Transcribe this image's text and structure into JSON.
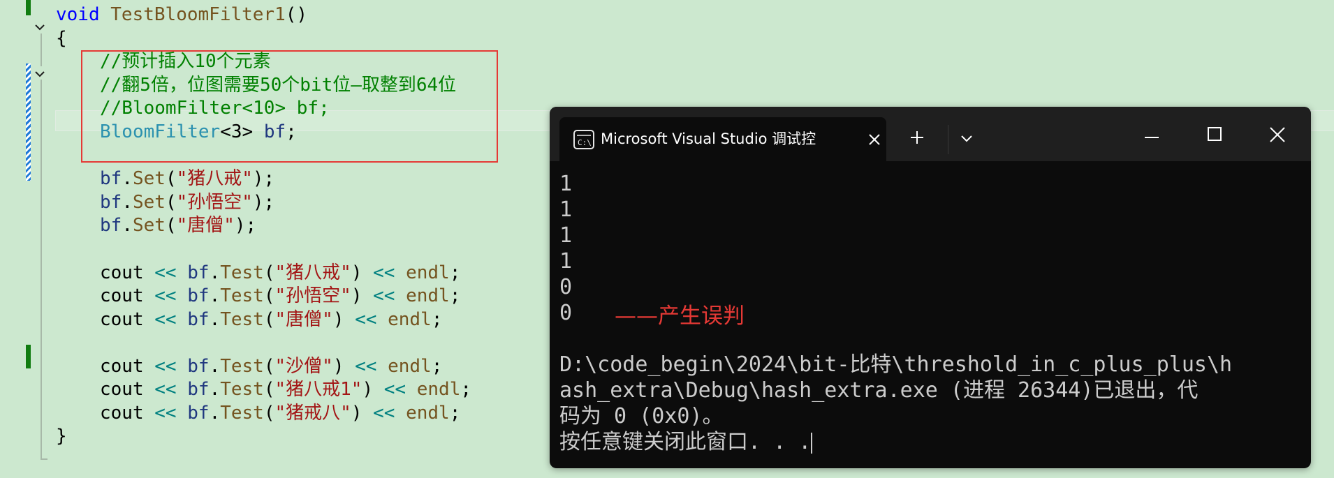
{
  "editor": {
    "lines": [
      {
        "id": "l1",
        "segs": [
          {
            "c": "kw",
            "t": "void"
          },
          {
            "c": "",
            "t": " "
          },
          {
            "c": "fn",
            "t": "TestBloomFilter1"
          },
          {
            "c": "",
            "t": "()"
          }
        ]
      },
      {
        "id": "l2",
        "segs": [
          {
            "c": "",
            "t": "{"
          }
        ]
      },
      {
        "id": "l3",
        "segs": [
          {
            "c": "cm",
            "t": "//预计插入10个元素"
          }
        ]
      },
      {
        "id": "l4",
        "segs": [
          {
            "c": "cm",
            "t": "//翻5倍，位图需要50个bit位—取整到64位"
          }
        ]
      },
      {
        "id": "l5",
        "segs": [
          {
            "c": "cm",
            "t": "//BloomFilter<10> bf;"
          }
        ]
      },
      {
        "id": "l6",
        "segs": [
          {
            "c": "ty",
            "t": "BloomFilter"
          },
          {
            "c": "",
            "t": "<3> "
          },
          {
            "c": "vr",
            "t": "bf"
          },
          {
            "c": "",
            "t": ";"
          }
        ]
      },
      {
        "id": "l7",
        "segs": [
          {
            "c": "vr",
            "t": "bf"
          },
          {
            "c": "",
            "t": "."
          },
          {
            "c": "fn",
            "t": "Set"
          },
          {
            "c": "",
            "t": "("
          },
          {
            "c": "st",
            "t": "\"猪八戒\""
          },
          {
            "c": "",
            "t": ");"
          }
        ]
      },
      {
        "id": "l8",
        "segs": [
          {
            "c": "vr",
            "t": "bf"
          },
          {
            "c": "",
            "t": "."
          },
          {
            "c": "fn",
            "t": "Set"
          },
          {
            "c": "",
            "t": "("
          },
          {
            "c": "st",
            "t": "\"孙悟空\""
          },
          {
            "c": "",
            "t": ");"
          }
        ]
      },
      {
        "id": "l9",
        "segs": [
          {
            "c": "vr",
            "t": "bf"
          },
          {
            "c": "",
            "t": "."
          },
          {
            "c": "fn",
            "t": "Set"
          },
          {
            "c": "",
            "t": "("
          },
          {
            "c": "st",
            "t": "\"唐僧\""
          },
          {
            "c": "",
            "t": ");"
          }
        ]
      },
      {
        "id": "l10",
        "segs": [
          {
            "c": "",
            "t": "cout "
          },
          {
            "c": "op",
            "t": "<<"
          },
          {
            "c": "",
            "t": " "
          },
          {
            "c": "vr",
            "t": "bf"
          },
          {
            "c": "",
            "t": "."
          },
          {
            "c": "fn",
            "t": "Test"
          },
          {
            "c": "",
            "t": "("
          },
          {
            "c": "st",
            "t": "\"猪八戒\""
          },
          {
            "c": "",
            "t": ") "
          },
          {
            "c": "op",
            "t": "<<"
          },
          {
            "c": "",
            "t": " "
          },
          {
            "c": "fn",
            "t": "endl"
          },
          {
            "c": "",
            "t": ";"
          }
        ]
      },
      {
        "id": "l11",
        "segs": [
          {
            "c": "",
            "t": "cout "
          },
          {
            "c": "op",
            "t": "<<"
          },
          {
            "c": "",
            "t": " "
          },
          {
            "c": "vr",
            "t": "bf"
          },
          {
            "c": "",
            "t": "."
          },
          {
            "c": "fn",
            "t": "Test"
          },
          {
            "c": "",
            "t": "("
          },
          {
            "c": "st",
            "t": "\"孙悟空\""
          },
          {
            "c": "",
            "t": ") "
          },
          {
            "c": "op",
            "t": "<<"
          },
          {
            "c": "",
            "t": " "
          },
          {
            "c": "fn",
            "t": "endl"
          },
          {
            "c": "",
            "t": ";"
          }
        ]
      },
      {
        "id": "l12",
        "segs": [
          {
            "c": "",
            "t": "cout "
          },
          {
            "c": "op",
            "t": "<<"
          },
          {
            "c": "",
            "t": " "
          },
          {
            "c": "vr",
            "t": "bf"
          },
          {
            "c": "",
            "t": "."
          },
          {
            "c": "fn",
            "t": "Test"
          },
          {
            "c": "",
            "t": "("
          },
          {
            "c": "st",
            "t": "\"唐僧\""
          },
          {
            "c": "",
            "t": ") "
          },
          {
            "c": "op",
            "t": "<<"
          },
          {
            "c": "",
            "t": " "
          },
          {
            "c": "fn",
            "t": "endl"
          },
          {
            "c": "",
            "t": ";"
          }
        ]
      },
      {
        "id": "l13",
        "segs": [
          {
            "c": "",
            "t": "cout "
          },
          {
            "c": "op",
            "t": "<<"
          },
          {
            "c": "",
            "t": " "
          },
          {
            "c": "vr",
            "t": "bf"
          },
          {
            "c": "",
            "t": "."
          },
          {
            "c": "fn",
            "t": "Test"
          },
          {
            "c": "",
            "t": "("
          },
          {
            "c": "st",
            "t": "\"沙僧\""
          },
          {
            "c": "",
            "t": ") "
          },
          {
            "c": "op",
            "t": "<<"
          },
          {
            "c": "",
            "t": " "
          },
          {
            "c": "fn",
            "t": "endl"
          },
          {
            "c": "",
            "t": ";"
          }
        ]
      },
      {
        "id": "l14",
        "segs": [
          {
            "c": "",
            "t": "cout "
          },
          {
            "c": "op",
            "t": "<<"
          },
          {
            "c": "",
            "t": " "
          },
          {
            "c": "vr",
            "t": "bf"
          },
          {
            "c": "",
            "t": "."
          },
          {
            "c": "fn",
            "t": "Test"
          },
          {
            "c": "",
            "t": "("
          },
          {
            "c": "st",
            "t": "\"猪八戒1\""
          },
          {
            "c": "",
            "t": ") "
          },
          {
            "c": "op",
            "t": "<<"
          },
          {
            "c": "",
            "t": " "
          },
          {
            "c": "fn",
            "t": "endl"
          },
          {
            "c": "",
            "t": ";"
          }
        ]
      },
      {
        "id": "l15",
        "segs": [
          {
            "c": "",
            "t": "cout "
          },
          {
            "c": "op",
            "t": "<<"
          },
          {
            "c": "",
            "t": " "
          },
          {
            "c": "vr",
            "t": "bf"
          },
          {
            "c": "",
            "t": "."
          },
          {
            "c": "fn",
            "t": "Test"
          },
          {
            "c": "",
            "t": "("
          },
          {
            "c": "st",
            "t": "\"猪戒八\""
          },
          {
            "c": "",
            "t": ") "
          },
          {
            "c": "op",
            "t": "<<"
          },
          {
            "c": "",
            "t": " "
          },
          {
            "c": "fn",
            "t": "endl"
          },
          {
            "c": "",
            "t": ";"
          }
        ]
      },
      {
        "id": "l16",
        "segs": [
          {
            "c": "",
            "t": "}"
          }
        ]
      }
    ]
  },
  "terminal": {
    "tab_title": "Microsoft Visual Studio 调试控",
    "new_tab_glyph": "+",
    "output_lines": [
      "1",
      "1",
      "1",
      "1",
      "0",
      "0",
      "",
      "D:\\code_begin\\2024\\bit-比特\\threshold_in_c_plus_plus\\h",
      "ash_extra\\Debug\\hash_extra.exe (进程 26344)已退出，代",
      "码为 0 (0x0)。",
      "按任意键关闭此窗口. . ."
    ],
    "annotation": "——产生误判"
  },
  "colors": {
    "editor_bg": "#cce8cf",
    "comment": "#008000",
    "keyword": "#0000ff",
    "string": "#a31515",
    "type": "#2b91af",
    "highlight_box": "#e53935",
    "terminal_bg": "#0c0c0c"
  }
}
